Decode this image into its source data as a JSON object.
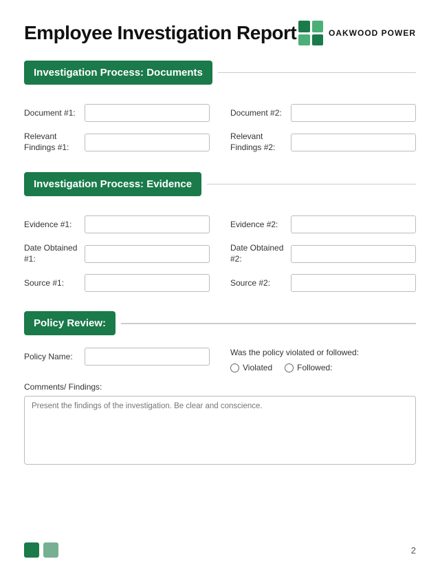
{
  "header": {
    "title": "Employee Investigation Report",
    "logo_name": "OAKWOOD POWER"
  },
  "sections": {
    "documents": {
      "label": "Investigation Process: Documents",
      "fields": [
        {
          "id": "doc1",
          "label": "Document #1:"
        },
        {
          "id": "doc2",
          "label": "Document #2:"
        },
        {
          "id": "rel1",
          "label": "Relevant\nFindings #1:"
        },
        {
          "id": "rel2",
          "label": "Relevant\nFindings #2:"
        }
      ]
    },
    "evidence": {
      "label": "Investigation Process: Evidence",
      "fields": [
        {
          "id": "ev1",
          "label": "Evidence #1:"
        },
        {
          "id": "ev2",
          "label": "Evidence #2:"
        },
        {
          "id": "do1",
          "label": "Date\nObtained #1:"
        },
        {
          "id": "do2",
          "label": "Date\nObtained #2:"
        },
        {
          "id": "src1",
          "label": "Source #1:"
        },
        {
          "id": "src2",
          "label": "Source #2:"
        }
      ]
    },
    "policy": {
      "label": "Policy Review:",
      "policy_name_label": "Policy Name:",
      "violated_question": "Was the policy violated or followed:",
      "violated_label": "Violated",
      "followed_label": "Followed:",
      "comments_label": "Comments/ Findings:",
      "comments_placeholder": "Present the findings of the investigation. Be clear and conscience."
    }
  },
  "footer": {
    "page_number": "2"
  }
}
